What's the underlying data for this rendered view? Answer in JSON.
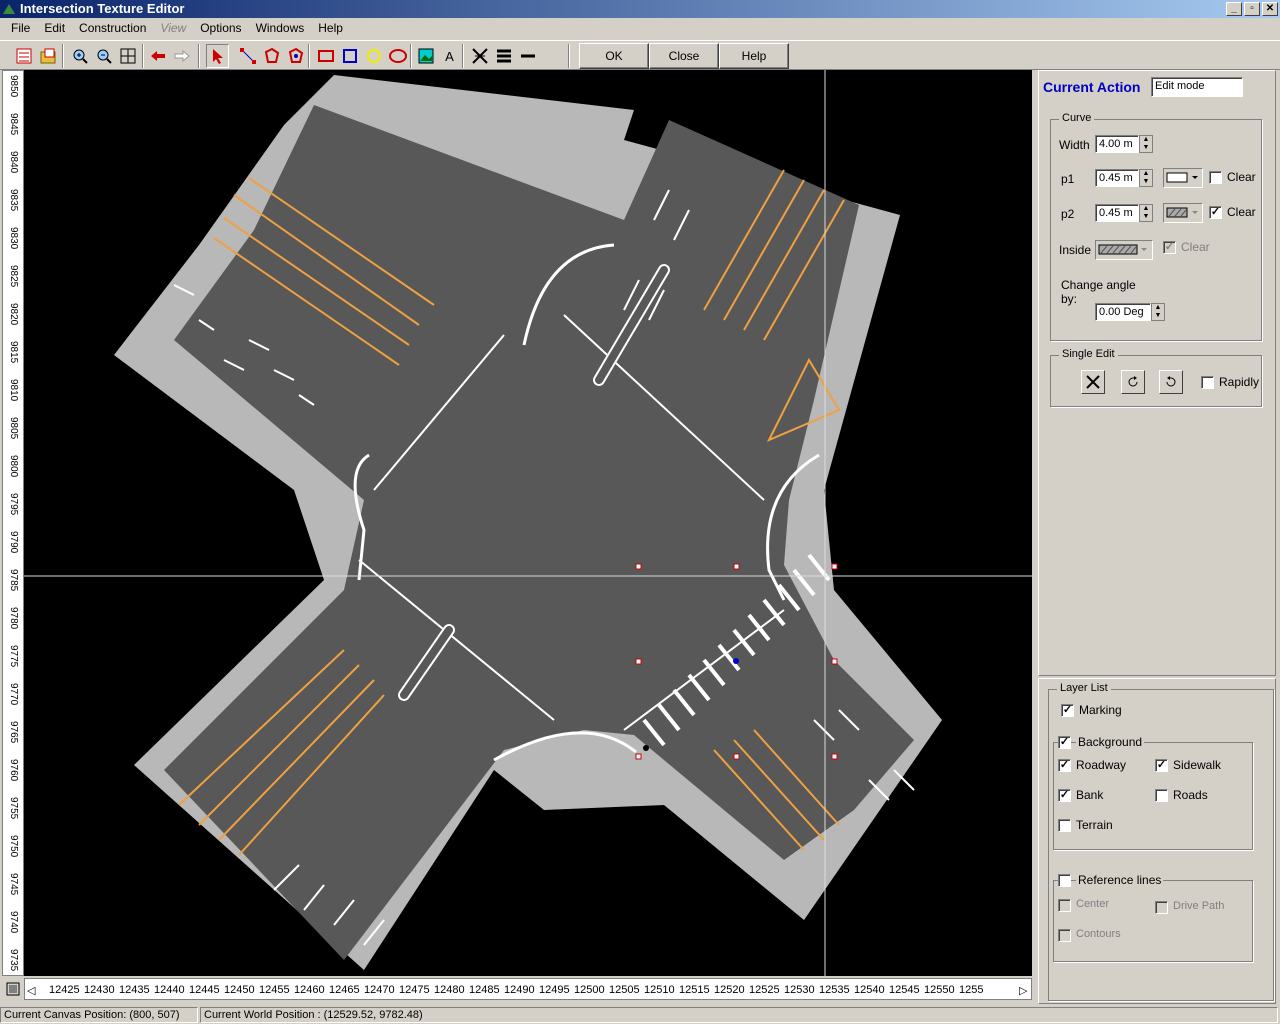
{
  "window": {
    "title": "Intersection Texture Editor",
    "minimize": "_",
    "maximize": "▫",
    "close": "✕"
  },
  "menu": [
    "File",
    "Edit",
    "Construction",
    "View",
    "Options",
    "Windows",
    "Help"
  ],
  "toolbar": {
    "ok": "OK",
    "close": "Close",
    "help": "Help",
    "text_tool": "A"
  },
  "vruler": [
    "9850",
    "9845",
    "9840",
    "9835",
    "9830",
    "9825",
    "9820",
    "9815",
    "9810",
    "9805",
    "9800",
    "9795",
    "9790",
    "9785",
    "9780",
    "9775",
    "9770",
    "9765",
    "9760",
    "9755",
    "9750",
    "9745",
    "9740",
    "9735",
    "973"
  ],
  "hruler": [
    "12425",
    "12430",
    "12435",
    "12440",
    "12445",
    "12450",
    "12455",
    "12460",
    "12465",
    "12470",
    "12475",
    "12480",
    "12485",
    "12490",
    "12495",
    "12500",
    "12505",
    "12510",
    "12515",
    "12520",
    "12525",
    "12530",
    "12535",
    "12540",
    "12545",
    "12550",
    "1255"
  ],
  "panel": {
    "current_action_label": "Current Action",
    "current_action_value": "Edit mode",
    "curve": {
      "title": "Curve",
      "width_label": "Width",
      "width_value": "4.00 m",
      "p1_label": "p1",
      "p1_value": "0.45 m",
      "p1_clear": "Clear",
      "p2_label": "p2",
      "p2_value": "0.45 m",
      "p2_clear": "Clear",
      "inside_label": "Inside",
      "inside_clear": "Clear",
      "angle_label": "Change angle",
      "angle_label2": "by:",
      "angle_value": "0.00 Deg"
    },
    "single_edit": {
      "title": "Single Edit",
      "rapidly": "Rapidly"
    }
  },
  "layers": {
    "title": "Layer List",
    "marking": "Marking",
    "background": "Background",
    "roadway": "Roadway",
    "sidewalk": "Sidewalk",
    "bank": "Bank",
    "roads": "Roads",
    "terrain": "Terrain",
    "reference": "Reference lines",
    "center": "Center",
    "drive_path": "Drive Path",
    "contours": "Contours"
  },
  "status": {
    "canvas": "Current Canvas Position: (800, 507)",
    "world": "Current World Position : (12529.52, 9782.48)"
  }
}
